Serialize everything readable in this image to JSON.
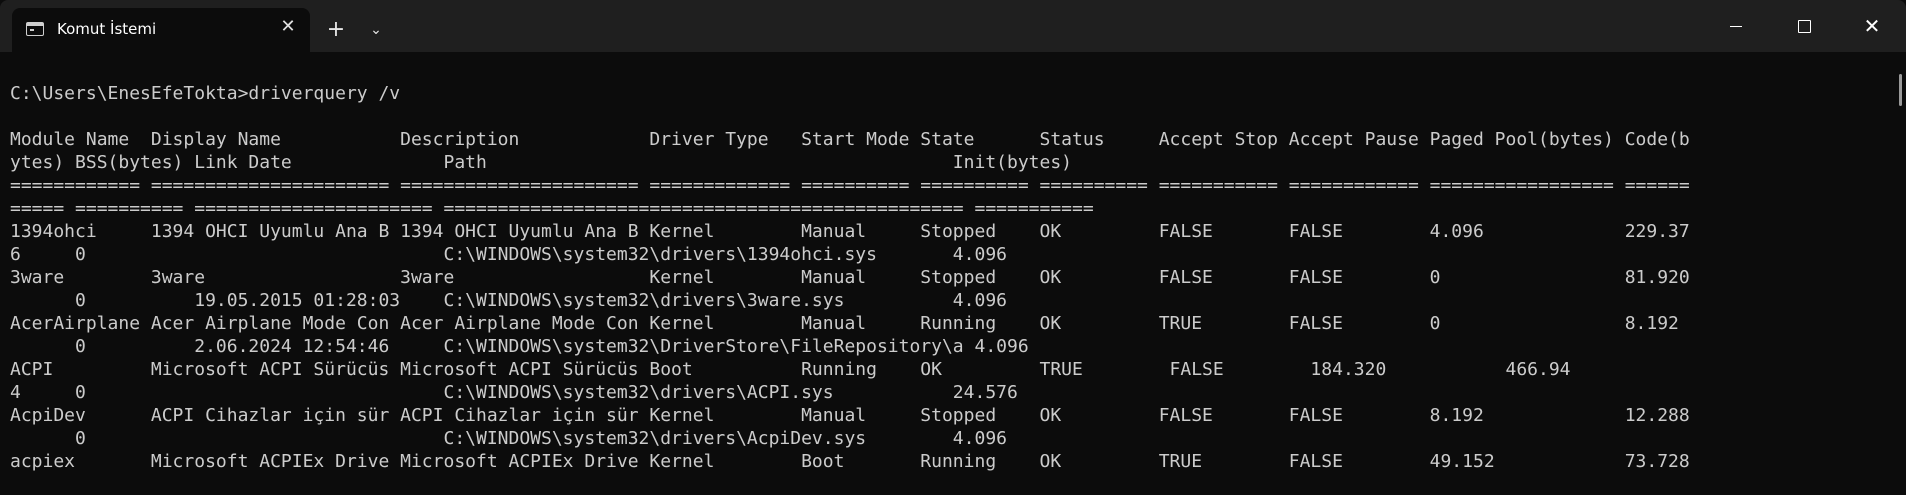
{
  "window": {
    "tab_title": "Komut İstemi",
    "tab_close_glyph": "✕",
    "new_tab_glyph": "+",
    "dropdown_glyph": "⌄",
    "close_glyph": "✕"
  },
  "terminal": {
    "prompt": "C:\\Users\\EnesEfeTokta>driverquery /v",
    "lines": [
      "Module Name  Display Name           Description            Driver Type   Start Mode State      Status     Accept Stop Accept Pause Paged Pool(bytes) Code(b",
      "ytes) BSS(bytes) Link Date              Path                                           Init(bytes)",
      "============ ====================== ====================== ============= ========== ========== ========== =========== ============ ================= ======",
      "===== ========== ====================== ================================================ ===========",
      "1394ohci     1394 OHCI Uyumlu Ana B 1394 OHCI Uyumlu Ana B Kernel        Manual     Stopped    OK         FALSE       FALSE        4.096             229.37",
      "6     0                                 C:\\WINDOWS\\system32\\drivers\\1394ohci.sys       4.096",
      "3ware        3ware                  3ware                  Kernel        Manual     Stopped    OK         FALSE       FALSE        0                 81.920",
      "      0          19.05.2015 01:28:03    C:\\WINDOWS\\system32\\drivers\\3ware.sys          4.096",
      "AcerAirplane Acer Airplane Mode Con Acer Airplane Mode Con Kernel        Manual     Running    OK         TRUE        FALSE        0                 8.192",
      "      0          2.06.2024 12:54:46     C:\\WINDOWS\\system32\\DriverStore\\FileRepository\\a 4.096",
      "ACPI         Microsoft ACPI Sürücüs Microsoft ACPI Sürücüs Boot          Running    OK         TRUE        FALSE        184.320           466.94",
      "4     0                                 C:\\WINDOWS\\system32\\drivers\\ACPI.sys           24.576",
      "AcpiDev      ACPI Cihazlar için sür ACPI Cihazlar için sür Kernel        Manual     Stopped    OK         FALSE       FALSE        8.192             12.288",
      "      0                                 C:\\WINDOWS\\system32\\drivers\\AcpiDev.sys        4.096",
      "acpiex       Microsoft ACPIEx Drive Microsoft ACPIEx Drive Kernel        Boot       Running    OK         TRUE        FALSE        49.152            73.728"
    ]
  }
}
